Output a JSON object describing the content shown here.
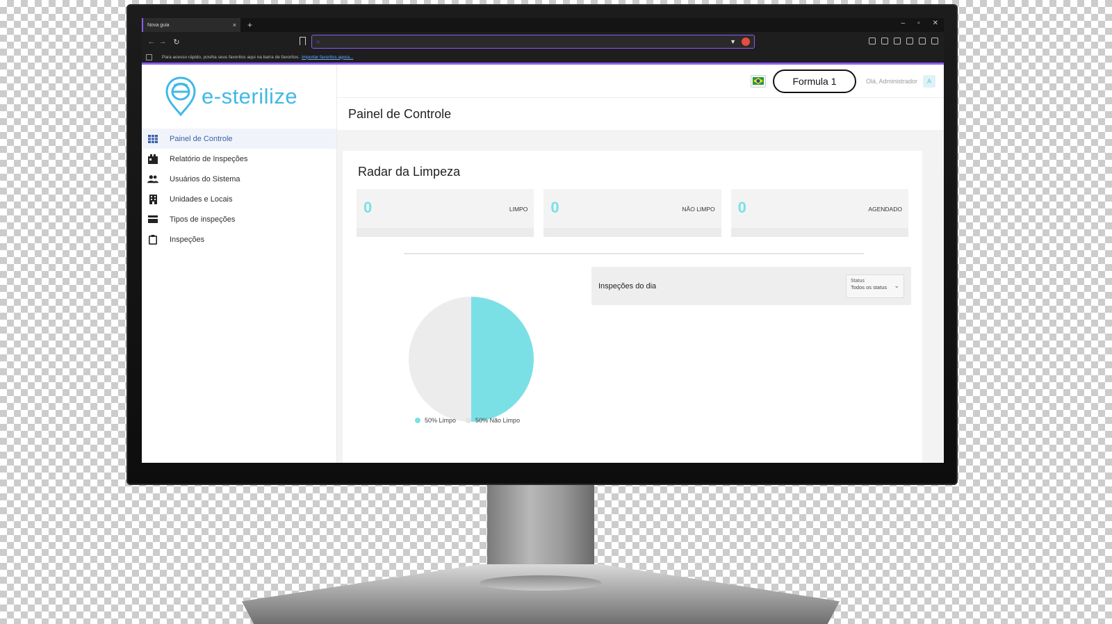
{
  "browser": {
    "tab_title": "Nova guia",
    "tab_close": "×",
    "new_tab": "+",
    "window_controls": [
      "–",
      "▫",
      "✕"
    ],
    "url_placeholder": "",
    "bookmarks_text": "Para acesso rápido, posiha seus favoritos aqui na barra de favoritos.",
    "bookmarks_link": "Importar favoritos agora..."
  },
  "brand": {
    "name": "e-sterilize",
    "color": "#3fb9e6"
  },
  "sidebar": {
    "items": [
      {
        "label": "Painel de Controle",
        "icon": "dashboard-grid-icon",
        "active": true
      },
      {
        "label": "Relatório de Inspeções",
        "icon": "report-icon",
        "active": false
      },
      {
        "label": "Usuários do Sistema",
        "icon": "users-icon",
        "active": false
      },
      {
        "label": "Unidades e Locais",
        "icon": "building-icon",
        "active": false
      },
      {
        "label": "Tipos de inspeções",
        "icon": "card-icon",
        "active": false
      },
      {
        "label": "Inspeções",
        "icon": "clipboard-icon",
        "active": false
      }
    ]
  },
  "header": {
    "tenant": "Formula 1",
    "greeting": "Olá, Administrador",
    "avatar_initial": "A",
    "flag_icon": "brazil-flag-icon"
  },
  "page": {
    "title": "Painel de Controle"
  },
  "radar": {
    "title": "Radar da Limpeza",
    "stats": [
      {
        "value": "0",
        "label": "LIMPO"
      },
      {
        "value": "0",
        "label": "NÃO LIMPO"
      },
      {
        "value": "0",
        "label": "AGENDADO"
      }
    ],
    "accent": "#7be0e6"
  },
  "chart_data": {
    "type": "pie",
    "categories": [
      "Limpo",
      "Não Limpo"
    ],
    "values": [
      50,
      50
    ],
    "colors": [
      "#7be0e6",
      "#ececec"
    ],
    "legend": [
      "50% Limpo",
      "50% Não Limpo"
    ],
    "legend_placement": "bottom"
  },
  "inspections": {
    "title": "Inspeções do dia",
    "status_label": "Status",
    "status_value": "Todos os status"
  }
}
